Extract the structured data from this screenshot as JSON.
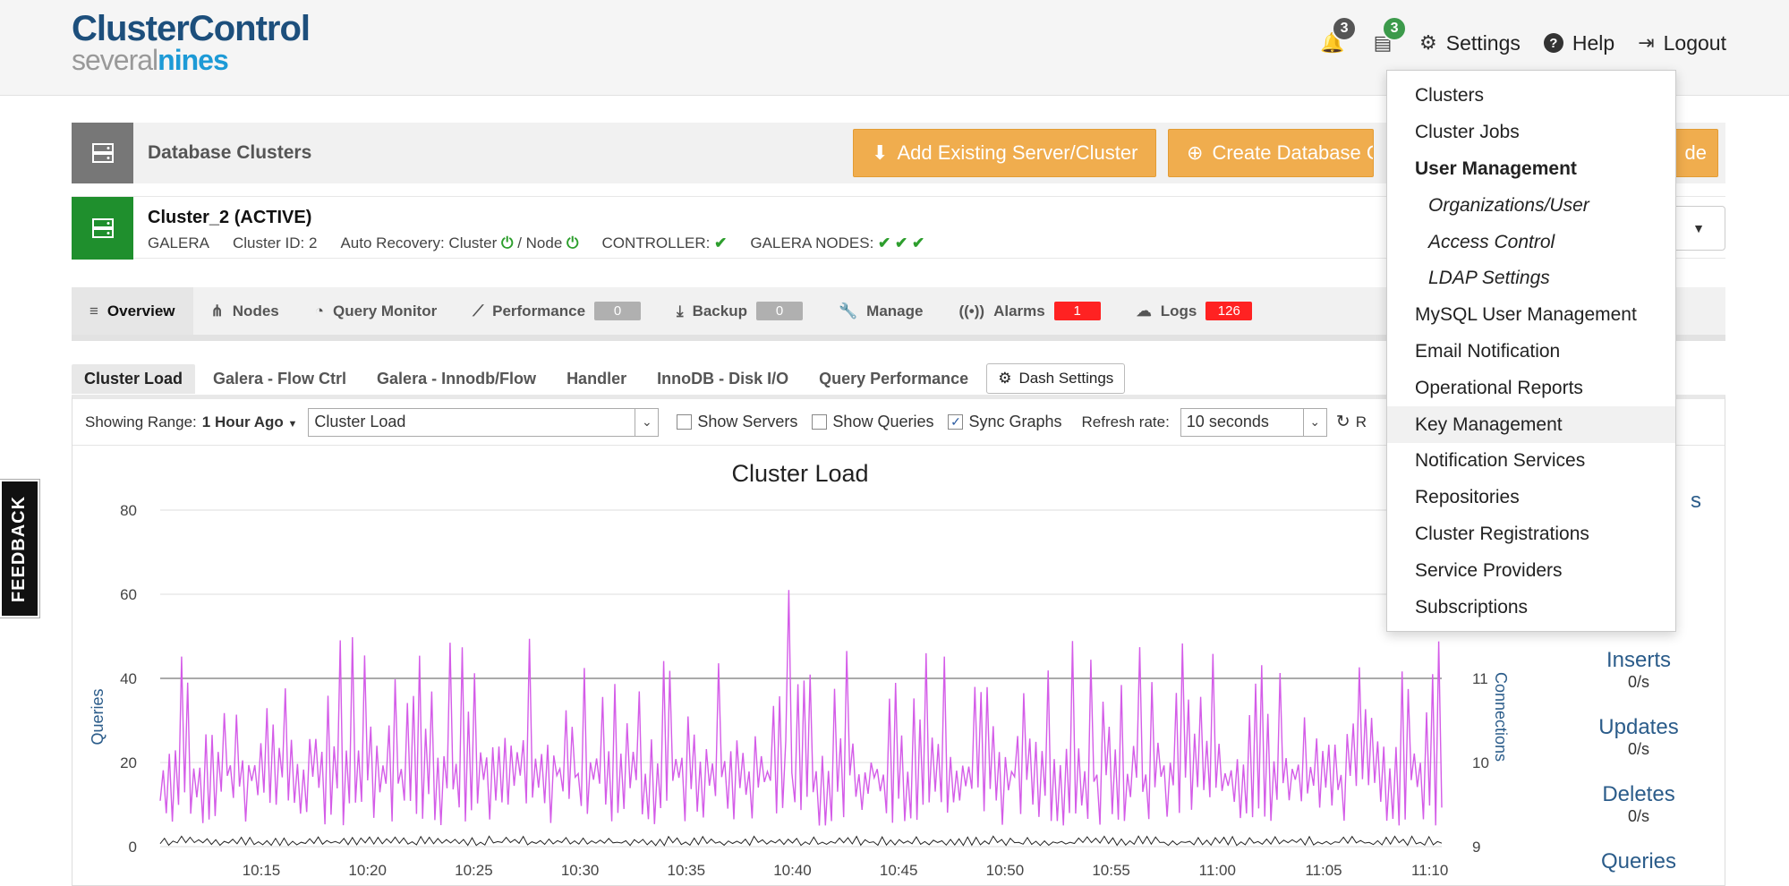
{
  "header": {
    "logo_main": "ClusterControl",
    "logo_sub_prefix": "several",
    "logo_sub_suffix": "nines",
    "alerts_count": "3",
    "jobs_count": "3",
    "settings_label": "Settings",
    "help_label": "Help",
    "logout_label": "Logout",
    "colors": {
      "alerts_badge": "#555555",
      "jobs_badge": "#3c9a4b"
    }
  },
  "db_bar": {
    "title": "Database Clusters",
    "add_existing_label": "Add Existing Server/Cluster",
    "create_label": "Create Database Cluster",
    "hidden_button_tail": "de"
  },
  "cluster": {
    "name": "Cluster_2 (ACTIVE)",
    "type": "GALERA",
    "cluster_id": "Cluster ID: 2",
    "auto_recovery": "Auto Recovery: Cluster",
    "node_sep": "/ Node",
    "controller": "CONTROLLER:",
    "galera_nodes": "GALERA NODES:"
  },
  "tabs": [
    {
      "label": "Overview",
      "icon": "menu-icon"
    },
    {
      "label": "Nodes",
      "icon": "sitemap-icon"
    },
    {
      "label": "Query Monitor",
      "icon": "gauge-icon"
    },
    {
      "label": "Performance",
      "icon": "line-chart-icon",
      "badge": "0"
    },
    {
      "label": "Backup",
      "icon": "download-icon",
      "badge": "0"
    },
    {
      "label": "Manage",
      "icon": "wrench-icon"
    },
    {
      "label": "Alarms",
      "icon": "broadcast-icon",
      "badge": "1"
    },
    {
      "label": "Logs",
      "icon": "log-icon",
      "badge": "126"
    }
  ],
  "subtabs": [
    "Cluster Load",
    "Galera - Flow Ctrl",
    "Galera - Innodb/Flow",
    "Handler",
    "InnoDB - Disk I/O",
    "Query Performance"
  ],
  "dash_settings_label": "Dash Settings",
  "controls": {
    "range_label": "Showing Range:",
    "range_value": "1 Hour Ago",
    "graph_select": "Cluster Load",
    "show_servers": "Show Servers",
    "show_queries": "Show Queries",
    "sync_graphs": "Sync Graphs",
    "refresh_label": "Refresh rate:",
    "refresh_value": "10 seconds",
    "reload_partial": "R"
  },
  "stats": [
    {
      "name": "Inserts",
      "value": "0/s"
    },
    {
      "name": "Updates",
      "value": "0/s"
    },
    {
      "name": "Deletes",
      "value": "0/s"
    },
    {
      "name": "Queries",
      "value": ""
    }
  ],
  "stats_partial_top": "s",
  "menu": {
    "items": [
      {
        "label": "Clusters",
        "kind": "item"
      },
      {
        "label": "Cluster Jobs",
        "kind": "item"
      },
      {
        "label": "User Management",
        "kind": "header"
      },
      {
        "label": "Organizations/User",
        "kind": "sub"
      },
      {
        "label": "Access Control",
        "kind": "sub"
      },
      {
        "label": "LDAP Settings",
        "kind": "sub"
      },
      {
        "label": "MySQL User Management",
        "kind": "item"
      },
      {
        "label": "Email Notification",
        "kind": "item"
      },
      {
        "label": "Operational Reports",
        "kind": "item"
      },
      {
        "label": "Key Management",
        "kind": "hover"
      },
      {
        "label": "Notification Services",
        "kind": "item"
      },
      {
        "label": "Repositories",
        "kind": "item"
      },
      {
        "label": "Cluster Registrations",
        "kind": "item"
      },
      {
        "label": "Service Providers",
        "kind": "item"
      },
      {
        "label": "Subscriptions",
        "kind": "item"
      }
    ]
  },
  "feedback_label": "FEEDBACK",
  "chart_data": {
    "type": "line",
    "title": "Cluster Load",
    "ylabel": "Queries",
    "y2label": "Connections",
    "ylim": [
      0,
      80
    ],
    "y2_ticks": [
      "9",
      "10",
      "11"
    ],
    "yticks": [
      0,
      20,
      40,
      60,
      80
    ],
    "x": [
      "10:15",
      "10:20",
      "10:25",
      "10:30",
      "10:35",
      "10:40",
      "10:45",
      "10:50",
      "10:55",
      "11:00",
      "11:05",
      "11:10"
    ],
    "series": [
      {
        "name": "",
        "color": "#d45ce8",
        "baseline": 15,
        "peak_min": 28,
        "peak_max": 50,
        "spike_time": "10:40",
        "spike_value": 61
      },
      {
        "name": "",
        "color": "#222222",
        "level": 1
      }
    ]
  }
}
